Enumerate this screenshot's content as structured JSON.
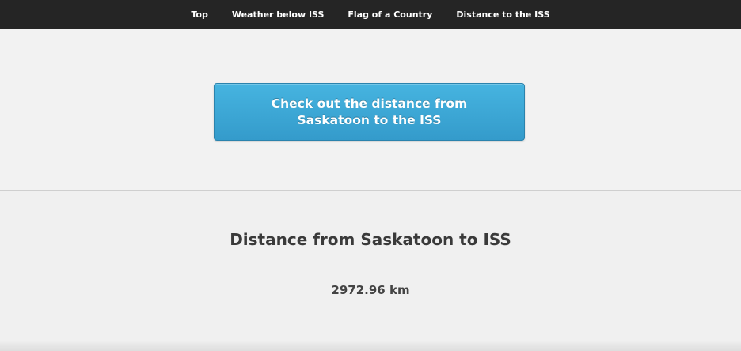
{
  "nav": {
    "items": [
      {
        "label": "Top"
      },
      {
        "label": "Weather below ISS"
      },
      {
        "label": "Flag of a Country"
      },
      {
        "label": "Distance to the ISS"
      }
    ]
  },
  "cta": {
    "label": "Check out the distance from Saskatoon to the ISS"
  },
  "result": {
    "title": "Distance from Saskatoon to ISS",
    "value": "2972.96 km"
  },
  "colors": {
    "nav_bg": "#252525",
    "button_top": "#46b4e0",
    "button_bottom": "#349bcb",
    "page_bg": "#f2f2f2",
    "text_dark": "#3a3a3a"
  }
}
